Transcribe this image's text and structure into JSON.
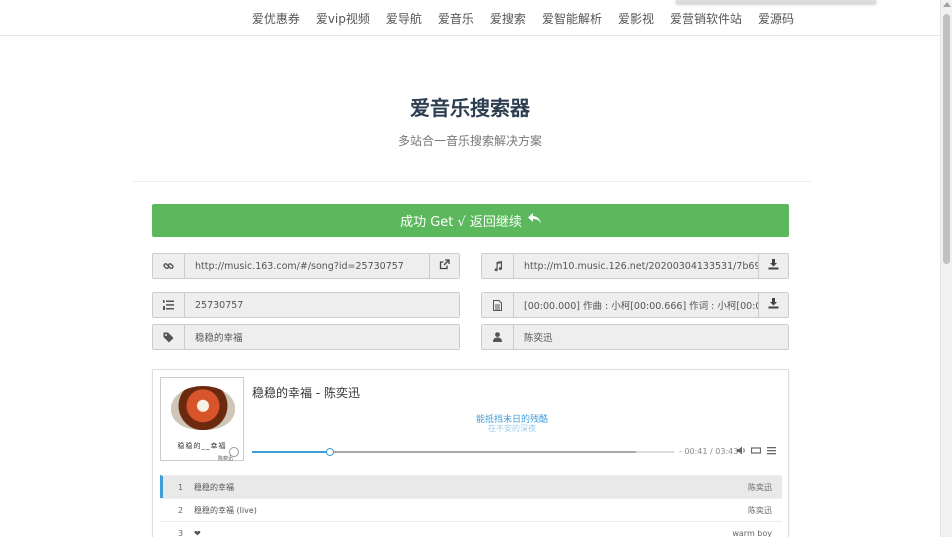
{
  "nav": {
    "items": [
      "爱优惠券",
      "爱vip视频",
      "爱导航",
      "爱音乐",
      "爱搜索",
      "爱智能解析",
      "爱影视",
      "爱营销软件站",
      "爱源码"
    ]
  },
  "header": {
    "title": "爱音乐搜索器",
    "subtitle": "多站合一音乐搜索解决方案"
  },
  "success": {
    "label": "成功 Get √ 返回继续"
  },
  "fields": {
    "song_url": "http://music.163.com/#/song?id=25730757",
    "audio_url": "http://m10.music.126.net/20200304133531/7b69a...",
    "song_id": "25730757",
    "lyrics": "[00:00.000] 作曲 : 小柯[00:00.666] 作词 : 小柯[00:0...",
    "song_name": "稳稳的幸福",
    "artist": "陈奕迅"
  },
  "player": {
    "title": "稳稳的幸福 - 陈奕迅",
    "lyric_current": "能抵挡末日的残酷",
    "lyric_next": "在不安的深夜",
    "time": "- 00:41 / 03:43",
    "progress_played": 0.185,
    "progress_loaded": 0.91,
    "cover_text": "稳稳的__幸福",
    "cover_sub": "陈奕迅"
  },
  "playlist": [
    {
      "index": "1",
      "name": "稳稳的幸福",
      "artist": "陈奕迅",
      "active": true
    },
    {
      "index": "2",
      "name": "稳稳的幸福 (live)",
      "artist": "陈奕迅",
      "active": false
    },
    {
      "index": "3",
      "name": "❤",
      "artist": "warm boy",
      "active": false
    }
  ],
  "colors": {
    "success": "#5cb85c",
    "accent": "#3d9ed8"
  }
}
